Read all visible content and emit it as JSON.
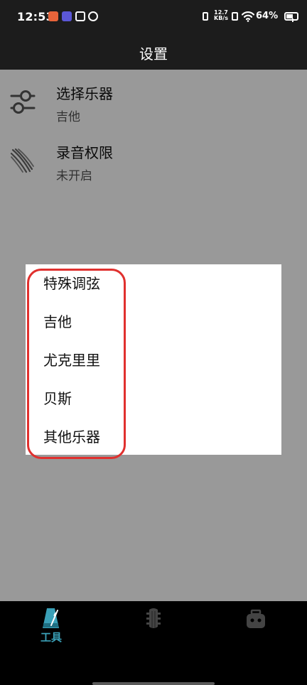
{
  "status_bar": {
    "time": "12:53",
    "net_speed_value": "12.7",
    "net_speed_unit": "KB/s",
    "battery_percent": "64%",
    "battery_level": 0.64
  },
  "app_bar": {
    "title": "设置"
  },
  "settings": {
    "items": [
      {
        "title": "选择乐器",
        "value": "吉他",
        "icon": "adjust-sliders-icon"
      },
      {
        "title": "录音权限",
        "value": "未开启",
        "icon": "microphone-waves-icon"
      }
    ]
  },
  "dialog": {
    "options": [
      "特殊调弦",
      "吉他",
      "尤克里里",
      "贝斯",
      "其他乐器"
    ]
  },
  "bottom_nav": {
    "tabs": [
      {
        "label": "工具",
        "icon": "metronome-icon",
        "active": true
      },
      {
        "label": "",
        "icon": "guitar-headstock-icon",
        "active": false
      },
      {
        "label": "",
        "icon": "robot-icon",
        "active": false
      }
    ]
  },
  "colors": {
    "accent": "#3aa0b7",
    "highlight": "#e0302e",
    "app_bar_bg": "#1c1c1c"
  }
}
